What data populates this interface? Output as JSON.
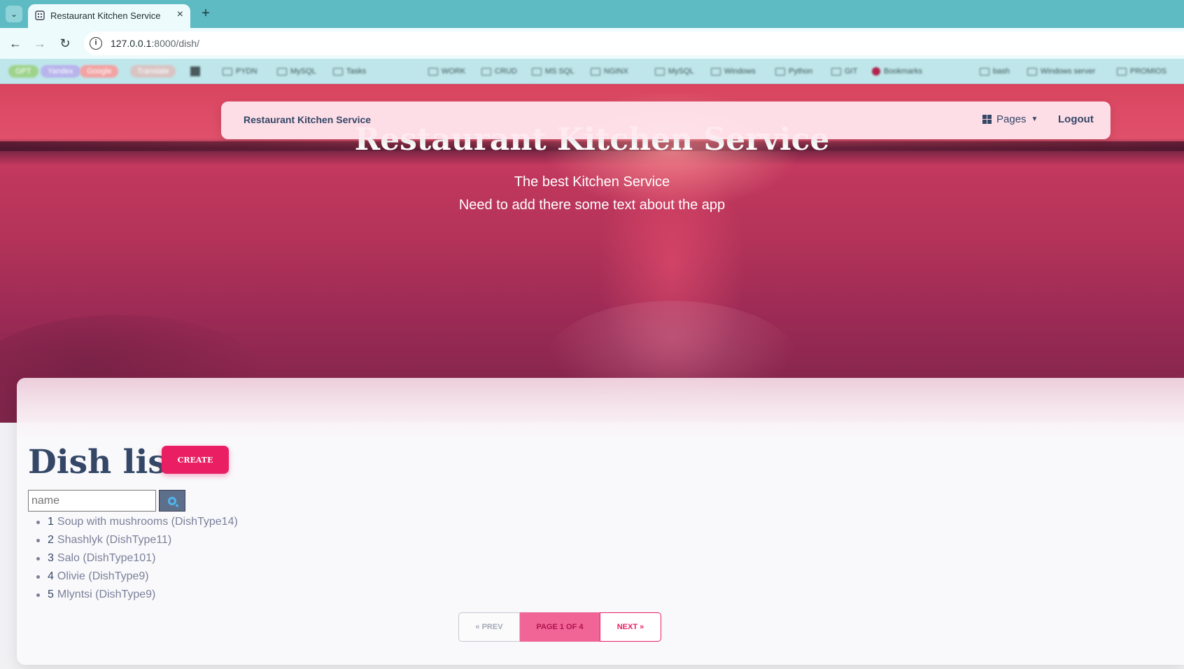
{
  "browser": {
    "tab_title": "Restaurant Kitchen Service",
    "url_host": "127.0.0.1",
    "url_path": ":8000/dish/",
    "bookmarks": [
      "GPT",
      "Yandex",
      "Google",
      "Translate",
      "PYDN",
      "MySQL",
      "Tasks",
      "WORK",
      "CRUD",
      "MS SQL",
      "NGINX",
      "MySQL",
      "Windows",
      "Python",
      "GIT",
      "Bookmarks",
      "bash",
      "Windows server",
      "PROMIOS"
    ]
  },
  "navbar": {
    "brand": "Restaurant Kitchen Service",
    "pages_label": "Pages",
    "logout_label": "Logout"
  },
  "hero": {
    "title": "Restaurant Kitchen Service",
    "subtitle": "The best Kitchen Service",
    "tagline": "Need to add there some text about the app"
  },
  "main": {
    "heading": "Dish list",
    "create_label": "CREATE",
    "search_placeholder": "name",
    "dishes": [
      {
        "num": "1",
        "name": "Soup with mushrooms (DishType14)"
      },
      {
        "num": "2",
        "name": "Shashlyk (DishType11)"
      },
      {
        "num": "3",
        "name": "Salo (DishType101)"
      },
      {
        "num": "4",
        "name": "Olivie (DishType9)"
      },
      {
        "num": "5",
        "name": "Mlyntsi (DishType9)"
      }
    ],
    "pagination": {
      "prev": "« PREV",
      "current": "PAGE 1 OF 4",
      "next": "NEXT »"
    }
  },
  "colors": {
    "accent": "#e91e63",
    "text_dark": "#344767",
    "text_muted": "#7b809a",
    "chrome_tab": "#5ebac3"
  }
}
